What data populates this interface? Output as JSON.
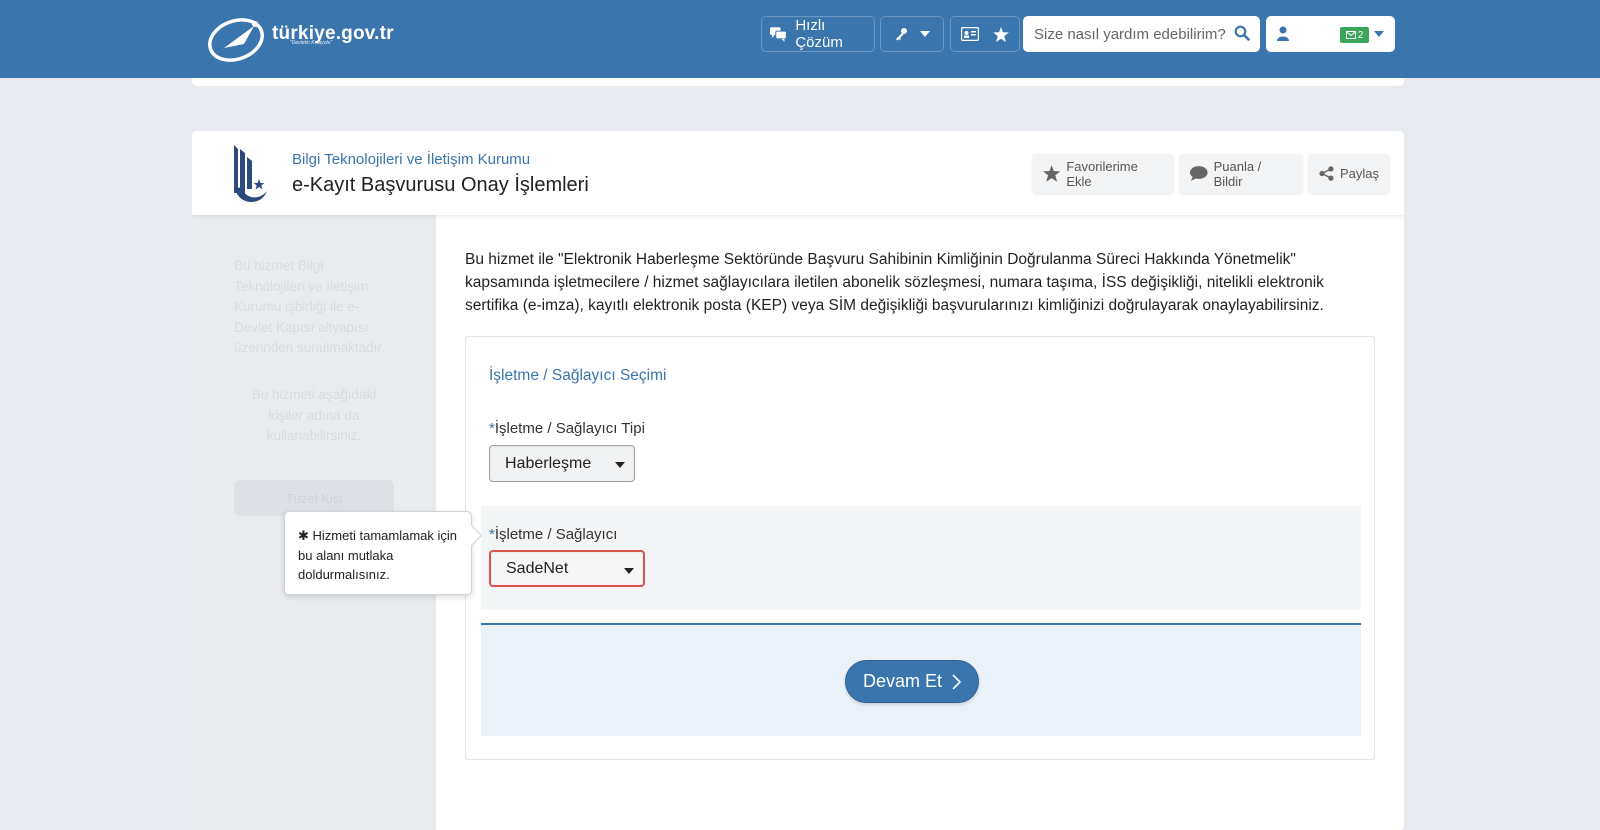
{
  "header": {
    "logo_text": "türkiye.gov.tr",
    "logo_sub": "\"Devletin Kısayolu\"",
    "quick_solution_label": "Hızlı Çözüm",
    "search_placeholder": "Size nasıl yardım edebilirim?",
    "mail_count": "2"
  },
  "service": {
    "institution": "Bilgi Teknolojileri ve İletişim Kurumu",
    "title": "e-Kayıt Başvurusu Onay İşlemleri",
    "actions": {
      "favorite": "Favorilerime Ekle",
      "rate": "Puanla / Bildir",
      "share": "Paylaş"
    }
  },
  "sidebar": {
    "info": "Bu hizmet Bilgi Teknolojileri ve İletişim Kurumu işbirliği ile e-Devlet Kapısı altyapısı üzerinden sunulmaktadır.",
    "usable_for": "Bu hizmeti aşağıdaki kişiler adına da kullanabilirsiniz.",
    "button": "Tüzel Kişi"
  },
  "description": "Bu hizmet ile \"Elektronik Haberleşme Sektöründe Başvuru Sahibinin Kimliğinin Doğrulanma Süreci Hakkında Yönetmelik\" kapsamında işletmecilere / hizmet sağlayıcılara iletilen abonelik sözleşmesi, numara taşıma, İSS değişikliği, nitelikli elektronik sertifika (e-imza), kayıtlı elektronik posta (KEP) veya SİM değişikliği başvurularınızı kimliğinizi doğrulayarak onaylayabilirsiniz.",
  "form": {
    "section_title": "İşletme / Sağlayıcı Seçimi",
    "required_mark": "*",
    "type_label": "İşletme / Sağlayıcı Tipi",
    "type_value": "Haberleşme",
    "provider_label": "İşletme / Sağlayıcı",
    "provider_value": "SadeNet",
    "continue_label": "Devam Et",
    "tooltip": "Hizmeti tamamlamak için bu alanı mutlaka doldurmalısınız.",
    "tooltip_mark": "✱"
  },
  "colors": {
    "brand_blue": "#3a75ad",
    "error_red": "#d9534f",
    "mail_green": "#3aa65c"
  }
}
